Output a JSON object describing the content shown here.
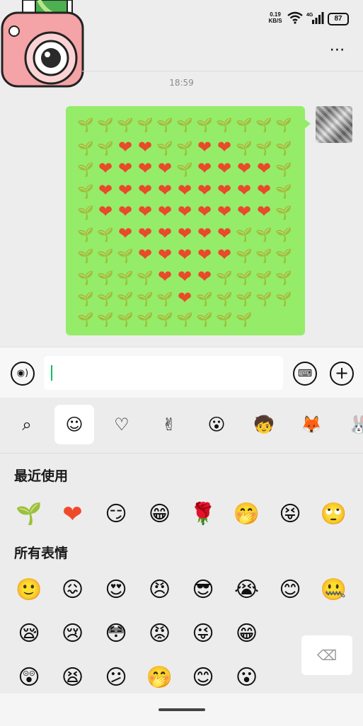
{
  "status_bar": {
    "net_speed_value": "0.19",
    "net_speed_unit": "KB/S",
    "network_type": "4G",
    "battery": "87"
  },
  "chat": {
    "time": "18:59",
    "more_icon": "more-dots-icon"
  },
  "message": {
    "grid": [
      "SSSSSSSSSSS",
      "SSHHSSHHSSS",
      "SHHHHSHHHHS",
      "SHHHHHHHHHS",
      "SHHHHHHHHHS",
      "SSHHHHHHSSS",
      "SSSHHHHHSSS",
      "SSSSHHHSSSS",
      "SSSSSHSSSSS",
      "SSSSSSSSS"
    ],
    "heart_color": "#e84a2a"
  },
  "input_bar": {
    "voice_icon": "voice-icon",
    "emoji_keyboard_icon": "keyboard-icon",
    "plus_icon": "plus-icon"
  },
  "emoji_panel": {
    "tabs": [
      {
        "icon": "search-icon",
        "glyph": "⌕"
      },
      {
        "icon": "smiley-icon",
        "glyph": "☺"
      },
      {
        "icon": "heart-outline-icon",
        "glyph": "♡"
      },
      {
        "icon": "sticker-hand-icon",
        "glyph": "✌"
      },
      {
        "icon": "sticker-face-icon",
        "glyph": "😮"
      },
      {
        "icon": "sticker-boy-icon",
        "glyph": "🧒"
      },
      {
        "icon": "sticker-fox-icon",
        "glyph": "🦊"
      },
      {
        "icon": "sticker-bunny-icon",
        "glyph": "🐰"
      }
    ],
    "recent_title": "最近使用",
    "all_title": "所有表情",
    "recent": [
      "🌱",
      "❤",
      "😏",
      "😁",
      "🌹",
      "🤭",
      "😝",
      "🙄"
    ],
    "all_rows": [
      [
        "🙂",
        "😖",
        "😍",
        "😠",
        "😎",
        "😭",
        "😊",
        "🤐"
      ],
      [
        "😪",
        "😢",
        "😳",
        "😡",
        "😜",
        "😁"
      ],
      [
        "😲",
        "😫",
        "😕",
        "🤭",
        "😊",
        "😮"
      ]
    ],
    "backspace_icon": "backspace-icon"
  }
}
